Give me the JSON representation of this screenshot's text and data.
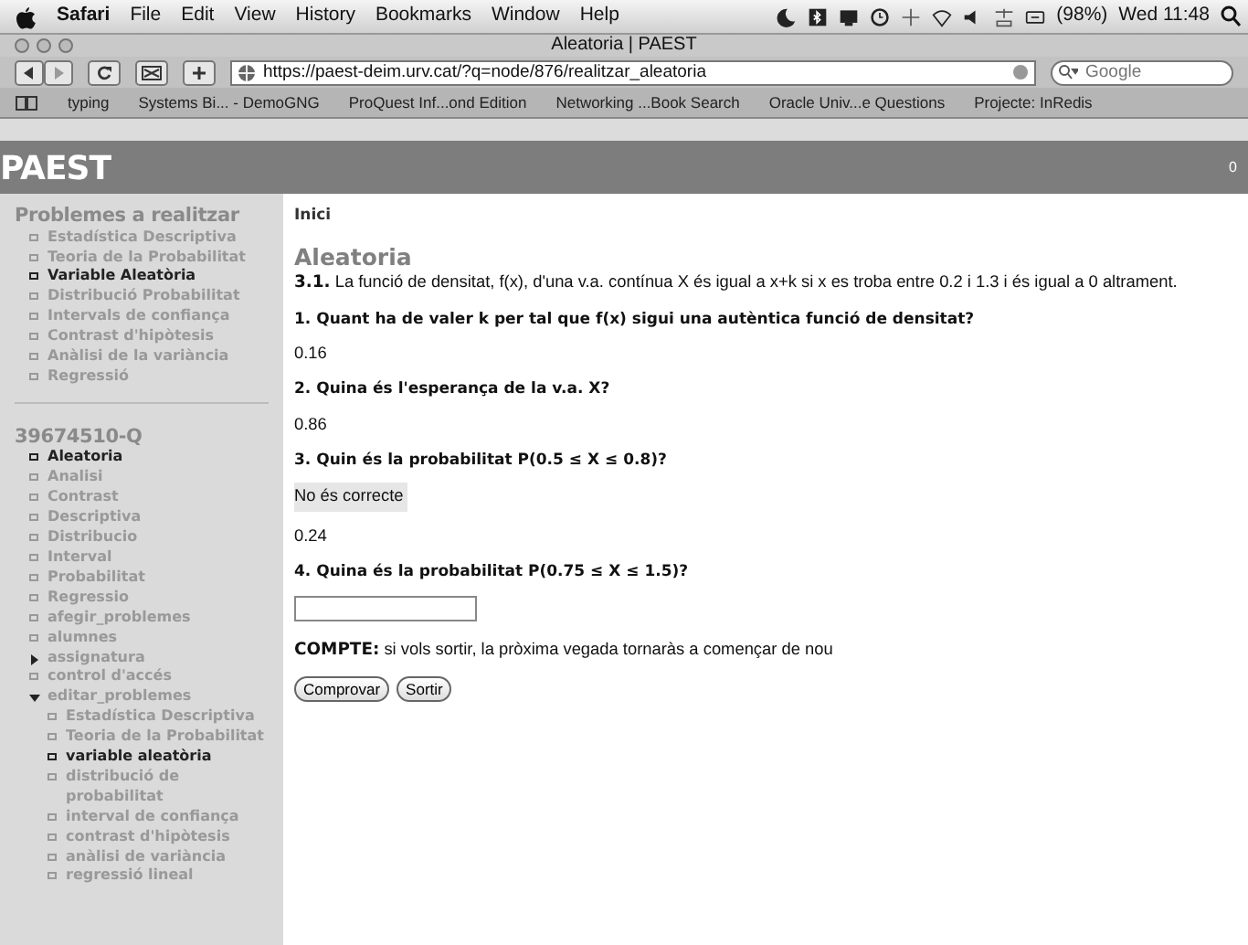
{
  "menubar": {
    "app": "Safari",
    "items": [
      "File",
      "Edit",
      "View",
      "History",
      "Bookmarks",
      "Window",
      "Help"
    ],
    "battery": "(98%)",
    "clock": "Wed 11:48"
  },
  "window": {
    "title": "Aleatoria | PAEST",
    "url": "https://paest-deim.urv.cat/?q=node/876/realitzar_aleatoria",
    "search": {
      "placeholder": "Google"
    },
    "bookmarks": [
      "typing",
      "Systems Bi... - DemoGNG",
      "ProQuest Inf...ond Edition",
      "Networking ...Book Search",
      "Oracle Univ...e Questions",
      "Projecte: InRedis"
    ]
  },
  "site": {
    "name": "PAEST",
    "counter": "0"
  },
  "sidebar": {
    "sections": [
      {
        "title": "Problemes a realitzar",
        "items": [
          {
            "label": "Estadística Descriptiva",
            "kind": "leaf",
            "selected": false
          },
          {
            "label": "Teoria de la Probabilitat",
            "kind": "leaf",
            "selected": false
          },
          {
            "label": "Variable Aleatòria",
            "kind": "leaf",
            "selected": true
          },
          {
            "label": "Distribució Probabilitat",
            "kind": "leaf",
            "selected": false
          },
          {
            "label": "Intervals de confiança",
            "kind": "leaf",
            "selected": false
          },
          {
            "label": "Contrast d'hipòtesis",
            "kind": "leaf",
            "selected": false
          },
          {
            "label": "Anàlisi de la variància",
            "kind": "leaf",
            "selected": false
          },
          {
            "label": "Regressió",
            "kind": "leaf",
            "selected": false
          }
        ]
      },
      {
        "title": "39674510-Q",
        "items": [
          {
            "label": "Aleatoria",
            "kind": "leaf",
            "selected": true
          },
          {
            "label": "Analisi",
            "kind": "leaf",
            "selected": false
          },
          {
            "label": "Contrast",
            "kind": "leaf",
            "selected": false
          },
          {
            "label": "Descriptiva",
            "kind": "leaf",
            "selected": false
          },
          {
            "label": "Distribucio",
            "kind": "leaf",
            "selected": false
          },
          {
            "label": "Interval",
            "kind": "leaf",
            "selected": false
          },
          {
            "label": "Probabilitat",
            "kind": "leaf",
            "selected": false
          },
          {
            "label": "Regressio",
            "kind": "leaf",
            "selected": false
          },
          {
            "label": "afegir_problemes",
            "kind": "leaf",
            "selected": false
          },
          {
            "label": "alumnes",
            "kind": "leaf",
            "selected": false
          },
          {
            "label": "assignatura",
            "kind": "folder",
            "expanded": false,
            "selected": false
          },
          {
            "label": "control d'accés",
            "kind": "leaf",
            "selected": false
          },
          {
            "label": "editar_problemes",
            "kind": "folder",
            "expanded": true,
            "selected": false,
            "children": [
              {
                "label": "Estadística Descriptiva",
                "kind": "leaf",
                "selected": false
              },
              {
                "label": "Teoria de la Probabilitat",
                "kind": "leaf",
                "selected": false
              },
              {
                "label": "variable aleatòria",
                "kind": "leaf",
                "selected": true
              },
              {
                "label": "distribució de probabilitat",
                "kind": "leaf",
                "selected": false
              },
              {
                "label": "interval de confiança",
                "kind": "leaf",
                "selected": false
              },
              {
                "label": "contrast d'hipòtesis",
                "kind": "leaf",
                "selected": false
              },
              {
                "label": "anàlisi de variància",
                "kind": "leaf",
                "selected": false
              },
              {
                "label": "regressió lineal",
                "kind": "leaf",
                "selected": false
              }
            ]
          }
        ]
      }
    ]
  },
  "content": {
    "breadcrumb": "Inici",
    "title": "Aleatoria",
    "intro": "**3.1.** La funció de densitat, f(x), d'una v.a. contínua X és igual a x+k si x es troba entre 0.2 i 1.3 i és igual a 0 altrament.",
    "blocks": [
      {
        "kind": "question",
        "text": "1. Quant ha de valer k per tal que f(x) sigui una autèntica funció de densitat?"
      },
      {
        "kind": "answer",
        "text": "0.16"
      },
      {
        "kind": "question",
        "text": "2. Quina és l'esperança de la v.a. X?"
      },
      {
        "kind": "answer",
        "text": "0.86"
      },
      {
        "kind": "question",
        "text": "3. Quin és la probabilitat P(0.5 ≤ X ≤ 0.8)?"
      },
      {
        "kind": "feedback",
        "text": "No és correcte"
      },
      {
        "kind": "answer",
        "text": "0.24"
      },
      {
        "kind": "question",
        "text": "4. Quina és la probabilitat P(0.75 ≤ X ≤ 1.5)?"
      },
      {
        "kind": "input"
      }
    ],
    "note": "**COMPTE:** si vols sortir, la pròxima vegada tornaràs a començar de nou",
    "buttons": [
      "Comprovar",
      "Sortir"
    ]
  }
}
